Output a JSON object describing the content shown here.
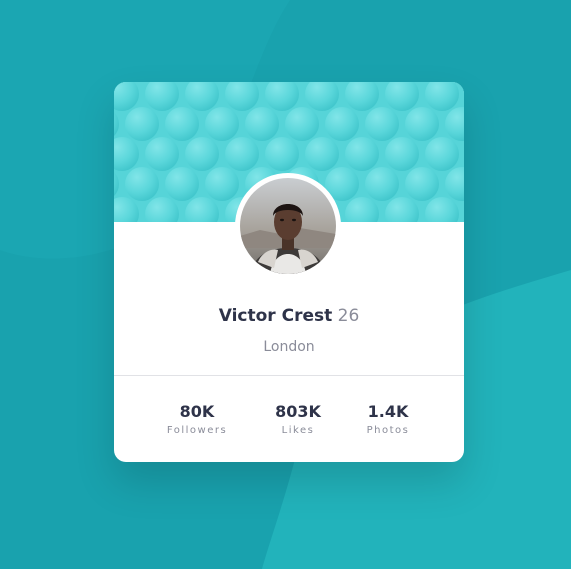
{
  "colors": {
    "background": "#19a2ae",
    "background_wave": "#22b3bb",
    "header": "#56d4d8",
    "card": "#ffffff",
    "name_text": "#2e3349",
    "muted_text": "#8a8c99",
    "divider": "#e1e2e6"
  },
  "profile": {
    "name": "Victor Crest",
    "age": "26",
    "location": "London",
    "avatar_icon": "user-photo"
  },
  "stats": [
    {
      "value": "80K",
      "label": "Followers"
    },
    {
      "value": "803K",
      "label": "Likes"
    },
    {
      "value": "1.4K",
      "label": "Photos"
    }
  ]
}
